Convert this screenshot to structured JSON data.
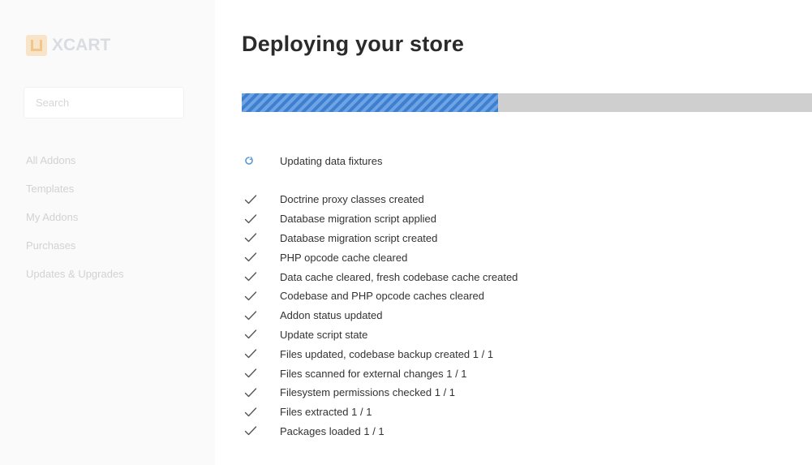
{
  "brand": {
    "name": "XCART"
  },
  "sidebar": {
    "search_placeholder": "Search",
    "items": [
      {
        "label": "All Addons"
      },
      {
        "label": "Templates"
      },
      {
        "label": "My Addons"
      },
      {
        "label": "Purchases"
      },
      {
        "label": "Updates & Upgrades"
      }
    ]
  },
  "main": {
    "title": "Deploying your store",
    "progress": {
      "fraction": 0.45
    },
    "current_step": {
      "label": "Updating data fixtures",
      "icon": "spinner-icon"
    },
    "completed_steps": [
      {
        "label": "Doctrine proxy classes created"
      },
      {
        "label": "Database migration script applied"
      },
      {
        "label": "Database migration script created"
      },
      {
        "label": "PHP opcode cache cleared"
      },
      {
        "label": "Data cache cleared, fresh codebase cache created"
      },
      {
        "label": "Codebase and PHP opcode caches cleared"
      },
      {
        "label": "Addon status updated"
      },
      {
        "label": "Update script state"
      },
      {
        "label": "Files updated, codebase backup created 1 / 1"
      },
      {
        "label": "Files scanned for external changes 1 / 1"
      },
      {
        "label": "Filesystem permissions checked 1 / 1"
      },
      {
        "label": "Files extracted 1 / 1"
      },
      {
        "label": "Packages loaded 1 / 1"
      }
    ]
  },
  "colors": {
    "progress_fill": "#3f7fd0",
    "progress_track": "#cfcfcf",
    "spinner": "#5b9bd8",
    "check": "#555555"
  }
}
